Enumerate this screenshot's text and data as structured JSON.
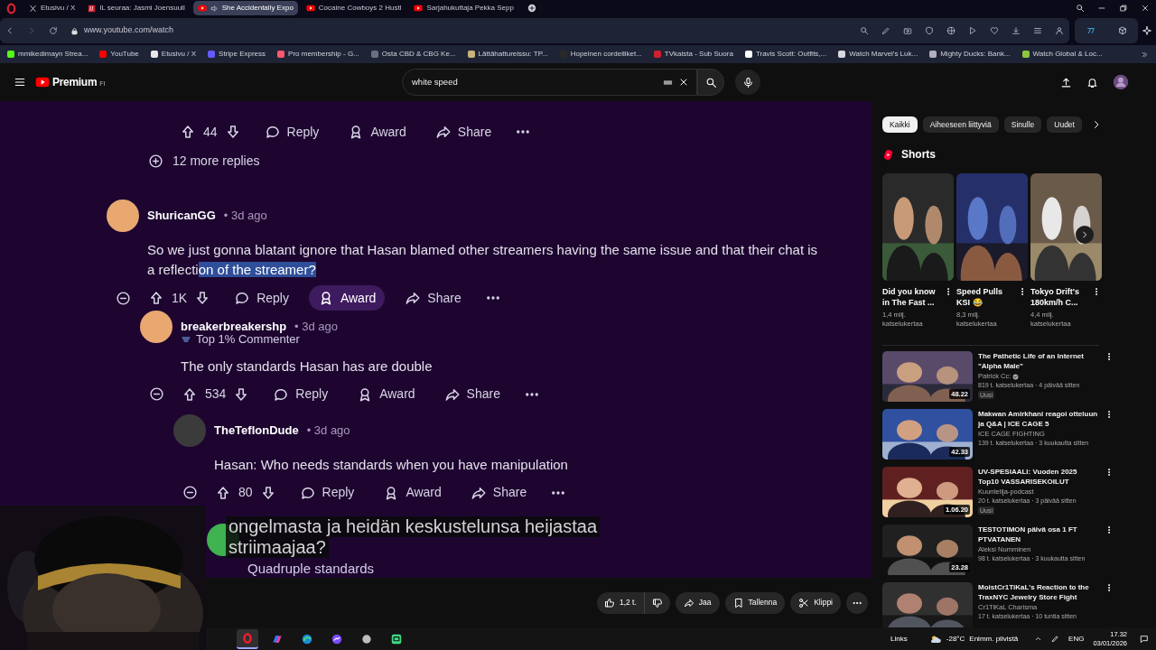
{
  "browser": {
    "tabs": [
      {
        "title": "Etusivu / X",
        "kind": "x",
        "selected": false,
        "audio": false
      },
      {
        "title": "IL seuraa: Jasmi Joensuull",
        "kind": "il",
        "selected": false,
        "audio": false
      },
      {
        "title": "She Accidentally Expo",
        "kind": "youtube",
        "selected": true,
        "audio": true
      },
      {
        "title": "Cocaine Cowboys 2 Hustl",
        "kind": "youtube",
        "selected": false,
        "audio": false
      },
      {
        "title": "Sarjahukuttaja Pekka Sepp",
        "kind": "youtube",
        "selected": false,
        "audio": false
      }
    ],
    "address": "www.youtube.com/watch",
    "bookmarks": [
      {
        "label": "mmikedimayn Strea...",
        "color": "#53fc18"
      },
      {
        "label": "YouTube",
        "color": "#ff0000"
      },
      {
        "label": "Etusivu / X",
        "color": "#e7e7e7"
      },
      {
        "label": "Stripe Express",
        "color": "#635bff"
      },
      {
        "label": "Pro membership - G...",
        "color": "#ff5a6e"
      },
      {
        "label": "Osta CBD & CBG Ke...",
        "color": "#6b6f80"
      },
      {
        "label": "Lättähattureissu: TP...",
        "color": "#c9b27a"
      },
      {
        "label": "Hopeinen cordelliket...",
        "color": "#2a2a2a"
      },
      {
        "label": "TVkaista - Sub Suora",
        "color": "#d0202e"
      },
      {
        "label": "Travis Scott: Outfits,...",
        "color": "#ffffff"
      },
      {
        "label": "Watch Marvel's Luk...",
        "color": "#d8d8e0"
      },
      {
        "label": "Mighty Ducks: Bank...",
        "color": "#b0b0c0"
      },
      {
        "label": "Watch Global & Loc...",
        "color": "#8cc63f"
      }
    ]
  },
  "youtube": {
    "logo": "Premium",
    "region": "FI",
    "search": "white speed"
  },
  "video": {
    "previous_actions": {
      "votes": "44",
      "actions": [
        {
          "label": "Reply",
          "hovered": false
        },
        {
          "label": "Award",
          "hovered": false
        },
        {
          "label": "Share",
          "hovered": false
        }
      ]
    },
    "more_replies": "12 more replies",
    "comments": [
      {
        "author": "ShuricanGG",
        "time": "• 3d ago",
        "color": "#e8a870",
        "text": "So we just gonna blatant ignore that Hasan blamed other streamers having the same issue and that their chat is a reflecti",
        "highlighted": "on of the streamer?",
        "votes": "1K",
        "actions": [
          {
            "label": "Reply",
            "hovered": false
          },
          {
            "label": "Award",
            "hovered": true
          },
          {
            "label": "Share",
            "hovered": false
          }
        ],
        "replies": [
          {
            "author": "breakerbreakershp",
            "time": "• 3d ago",
            "color": "#e8a870",
            "flair": "Top 1% Commenter",
            "text": "The only standards Hasan has are double",
            "votes": "534",
            "actions": [
              {
                "label": "Reply",
                "hovered": false
              },
              {
                "label": "Award",
                "hovered": false
              },
              {
                "label": "Share",
                "hovered": false
              }
            ],
            "replies": [
              {
                "author": "TheTeflonDude",
                "time": "• 3d ago",
                "color": "#3b3b3b",
                "text": "Hasan: Who needs standards when you have manipulation",
                "votes": "80",
                "actions": [
                  {
                    "label": "Reply",
                    "hovered": false
                  },
                  {
                    "label": "Award",
                    "hovered": false
                  },
                  {
                    "label": "Share",
                    "hovered": false
                  }
                ],
                "replies": [
                  {
                    "color": "#3fb34f",
                    "text": "Quadruple standards"
                  }
                ]
              }
            ]
          }
        ]
      }
    ],
    "subtitle": [
      "ongelmasta ja heidän keskustelunsa heijastaa",
      "striimaajaa?"
    ]
  },
  "video_actions": {
    "likes": "1,2 t.",
    "buttons": [
      {
        "kind": "share",
        "label": "Jaa"
      },
      {
        "kind": "save",
        "label": "Tallenna"
      },
      {
        "kind": "clip",
        "label": "Klippi"
      }
    ]
  },
  "sidebar": {
    "chips": [
      {
        "label": "Kaikki",
        "selected": true
      },
      {
        "label": "Aiheeseen liittyviä",
        "selected": false
      },
      {
        "label": "Sinulle",
        "selected": false
      },
      {
        "label": "Uudet",
        "selected": false
      }
    ],
    "shorts_heading": "Shorts",
    "shorts": [
      {
        "title": "Did you know in The Fast ...",
        "views": "1,4 milj. katselukertaa"
      },
      {
        "title": "Speed Pulls KSI 😂",
        "views": "8,3 milj. katselukertaa"
      },
      {
        "title": "Tokyo Drift's 180km/h C...",
        "views": "4,4 milj. katselukertaa"
      }
    ],
    "videos": [
      {
        "title": "The Pathetic Life of an Internet \"Alpha Male\"",
        "channel": "Patrick Cc:",
        "verified": true,
        "meta": "819 t. katselukertaa · 4 päivää sitten",
        "badge": "Uusi",
        "duration": "48.22"
      },
      {
        "title": "Makwan Amirkhani reagoi otteluun ja Q&A | ICE CAGE 5",
        "channel": "ICE CAGE FIGHTING",
        "verified": false,
        "meta": "139 t. katselukertaa · 3 kuukautta sitten",
        "duration": "42.33"
      },
      {
        "title": "UV-SPESIAALI: Vuoden 2025 Top10 VASSARISEKOILUT",
        "channel": "Kuuntelija-podcast",
        "verified": false,
        "meta": "20 t. katselukertaa · 3 päivää sitten",
        "badge": "Uusi",
        "duration": "1.06.20"
      },
      {
        "title": "TESTOTIMON päivä osa 1 FT PTVATANEN",
        "channel": "Aleksi Numminen",
        "verified": false,
        "meta": "98 t. katselukertaa · 3 kuukautta sitten",
        "duration": "23.28"
      },
      {
        "title": "MoistCr1TiKaL's Reaction to the TraxNYC Jewelry Store Fight",
        "channel": "Cr1TiKaL Charisma",
        "verified": false,
        "meta": "17 t. katselukertaa · 10 tuntia sitten"
      }
    ]
  },
  "taskbar": {
    "apps": [
      {
        "kind": "opera",
        "selected": true
      },
      {
        "kind": "copilot",
        "selected": false
      },
      {
        "kind": "edge",
        "selected": false
      },
      {
        "kind": "messenger",
        "selected": false
      },
      {
        "kind": "app",
        "selected": false
      },
      {
        "kind": "chat",
        "selected": false
      }
    ],
    "links": "Links",
    "temperature": "-28°C",
    "weather": "Enimm. pilvistä",
    "language": "ENG",
    "time": "17.32",
    "date": "03/01/2026"
  }
}
